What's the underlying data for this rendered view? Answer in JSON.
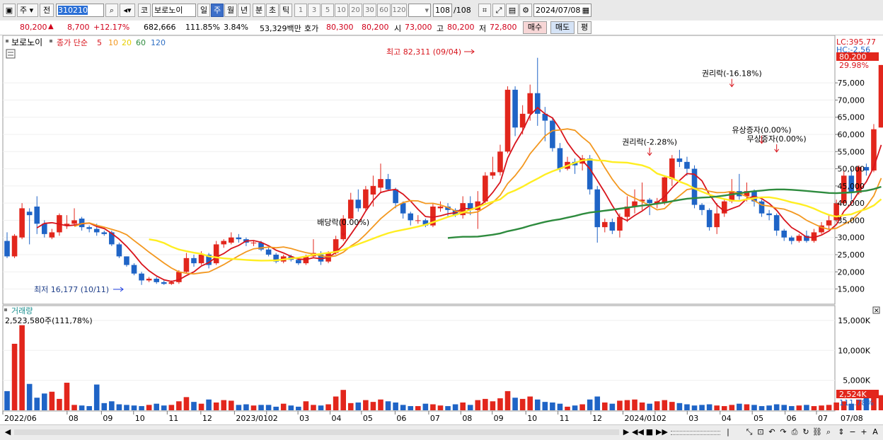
{
  "toolbar": {
    "type_label": "주",
    "prev_label": "전",
    "code_value": "310210",
    "name_value": "보로노이",
    "kospi_badge": "코",
    "periods": [
      "일",
      "주",
      "월",
      "년",
      "분",
      "초",
      "틱"
    ],
    "active_period": "주",
    "intervals": [
      "1",
      "3",
      "5",
      "10",
      "20",
      "30",
      "60",
      "120"
    ],
    "count_value": "108",
    "count_total": "/108",
    "date_value": "2024/07/08"
  },
  "quote": {
    "price": "80,200",
    "arrow": "▲",
    "change": "8,700",
    "change_rate": "+12.17%",
    "volume": "682,666",
    "volume_ratio": "111.85%",
    "turnover": "3.84%",
    "trade_value": "53,329백만",
    "ask_label": "호가",
    "ask1": "80,300",
    "ask2": "80,200",
    "open_label": "시",
    "open": "73,000",
    "high_label": "고",
    "high": "80,200",
    "low_label": "저",
    "low": "72,800",
    "buy_label": "매수",
    "sell_label": "매도",
    "eval_label": "평"
  },
  "colors": {
    "up": "#e2261c",
    "down": "#1f64c6",
    "ma5": "#d8141c",
    "ma10": "#f39820",
    "ma20": "#ffee22",
    "ma60": "#2e8b3e",
    "ma120": "#2e6fc4"
  },
  "legend": {
    "name": "보로노이",
    "series": "종가 단순",
    "periods": [
      "5",
      "10",
      "20",
      "60",
      "120"
    ]
  },
  "price_panel": {
    "lc_label": "LC:395.77",
    "hc_label": "HC:-2.56",
    "current_tag": "80,200",
    "current_pct": "29.98%",
    "hi_annot": "최고 82,311 (09/04)",
    "lo_annot": "최저 16,177 (10/11)",
    "events": [
      {
        "label": "배당락(0.00%)",
        "price": 31200,
        "week": 45
      },
      {
        "label": "권리락(-2.28%)",
        "price": 54500,
        "week": 86
      },
      {
        "label": "권리락(-16.18%)",
        "price": 74500,
        "week": 97
      },
      {
        "label": "유상증자(0.00%)",
        "price": 58000,
        "week": 101
      },
      {
        "label": "무상증자(0.00%)",
        "price": 55500,
        "week": 103
      },
      {
        "label": "배당락(0.00%)",
        "price": 56600,
        "week": 125
      }
    ]
  },
  "volume_panel": {
    "title": "거래량",
    "value_text": "2,523,580주(111,78%)",
    "current_tag": "2,524K",
    "current_pct": "111.78%"
  },
  "axes": {
    "x_labels": [
      "2022/06",
      "08",
      "09",
      "10",
      "11",
      "12",
      "2023/01",
      "02",
      "03",
      "04",
      "05",
      "06",
      "07",
      "08",
      "09",
      "10",
      "11",
      "12",
      "2024/01",
      "02",
      "03",
      "04",
      "05",
      "06",
      "07"
    ],
    "x_right": "07/08"
  },
  "chart_data": {
    "type": "candlestick",
    "price_ylim": [
      11000,
      88000
    ],
    "price_ticks": [
      15000,
      20000,
      25000,
      30000,
      35000,
      40000,
      45000,
      50000,
      55000,
      60000,
      65000,
      70000,
      75000
    ],
    "volume_ylim": [
      0,
      17000
    ],
    "volume_ticks": [
      5000,
      10000,
      15000
    ],
    "volume_unit": "K",
    "candles": [
      [
        29000,
        24500,
        31500,
        24000
      ],
      [
        24500,
        30500,
        31000,
        24000
      ],
      [
        30000,
        38500,
        40000,
        29500
      ],
      [
        37500,
        36500,
        38500,
        28000
      ],
      [
        39000,
        34000,
        42000,
        31000
      ],
      [
        34000,
        31000,
        35000,
        30000
      ],
      [
        30000,
        31500,
        32500,
        29500
      ],
      [
        31500,
        36500,
        37000,
        30500
      ],
      [
        33500,
        34000,
        36500,
        32500
      ],
      [
        34000,
        35000,
        38500,
        33500
      ],
      [
        35500,
        33000,
        36000,
        32000
      ],
      [
        33000,
        32500,
        33500,
        31500
      ],
      [
        32500,
        31500,
        34000,
        30500
      ],
      [
        31500,
        31000,
        32000,
        30500
      ],
      [
        31500,
        28000,
        32000,
        27500
      ],
      [
        28000,
        24500,
        28500,
        24000
      ],
      [
        24500,
        22000,
        24500,
        21500
      ],
      [
        22000,
        19500,
        22500,
        19000
      ],
      [
        19500,
        17500,
        20000,
        16200
      ],
      [
        17500,
        18000,
        18500,
        17000
      ],
      [
        18000,
        17000,
        18500,
        16500
      ],
      [
        17000,
        16500,
        17500,
        16200
      ],
      [
        16500,
        17000,
        17500,
        16200
      ],
      [
        17000,
        20000,
        20500,
        16500
      ],
      [
        20000,
        24000,
        25500,
        19500
      ],
      [
        24000,
        22500,
        25000,
        21500
      ],
      [
        22500,
        25000,
        26000,
        22000
      ],
      [
        25000,
        22000,
        25500,
        21000
      ],
      [
        22500,
        28000,
        29000,
        22000
      ],
      [
        28000,
        29000,
        29500,
        27000
      ],
      [
        28500,
        30000,
        31500,
        28000
      ],
      [
        30000,
        29500,
        31000,
        28500
      ],
      [
        29500,
        28500,
        30000,
        27500
      ],
      [
        28500,
        28500,
        29000,
        27500
      ],
      [
        28500,
        26500,
        29000,
        26000
      ],
      [
        26500,
        25000,
        27000,
        24500
      ],
      [
        25000,
        23000,
        25500,
        22500
      ],
      [
        23000,
        24500,
        25000,
        22500
      ],
      [
        24500,
        23500,
        25000,
        23000
      ],
      [
        23500,
        22500,
        24000,
        22000
      ],
      [
        22500,
        24500,
        25000,
        22000
      ],
      [
        24500,
        25500,
        29500,
        24000
      ],
      [
        25000,
        23000,
        26000,
        22000
      ],
      [
        23000,
        25500,
        26000,
        22500
      ],
      [
        25500,
        29500,
        30500,
        25000
      ],
      [
        29500,
        35500,
        36500,
        29000
      ],
      [
        35500,
        41000,
        43000,
        35000
      ],
      [
        41000,
        38500,
        44000,
        37500
      ],
      [
        38500,
        44000,
        45000,
        37500
      ],
      [
        42500,
        45000,
        48000,
        39000
      ],
      [
        44500,
        47000,
        51500,
        43000
      ],
      [
        47000,
        44000,
        48500,
        43500
      ],
      [
        44000,
        40000,
        44500,
        38500
      ],
      [
        40000,
        37000,
        40500,
        35500
      ],
      [
        37000,
        35000,
        37500,
        33500
      ],
      [
        35000,
        35000,
        36500,
        34000
      ],
      [
        35000,
        33500,
        35500,
        33000
      ],
      [
        33500,
        39000,
        40000,
        33000
      ],
      [
        38500,
        39000,
        40500,
        37500
      ],
      [
        39000,
        38000,
        40000,
        36000
      ],
      [
        38000,
        36500,
        38500,
        36000
      ],
      [
        36500,
        40000,
        42000,
        35500
      ],
      [
        40000,
        38000,
        42000,
        36500
      ],
      [
        38000,
        40500,
        43500,
        32500
      ],
      [
        40500,
        48000,
        49000,
        40000
      ],
      [
        48000,
        49000,
        53500,
        47000
      ],
      [
        49000,
        55000,
        57000,
        48000
      ],
      [
        55000,
        73000,
        74000,
        54500
      ],
      [
        73000,
        62000,
        74000,
        59500
      ],
      [
        62000,
        66000,
        68500,
        60000
      ],
      [
        66000,
        72000,
        74500,
        64000
      ],
      [
        72000,
        66000,
        82300,
        62500
      ],
      [
        66000,
        64000,
        68000,
        58000
      ],
      [
        64000,
        56000,
        65000,
        55000
      ],
      [
        56000,
        50000,
        57500,
        49000
      ],
      [
        50000,
        52000,
        53500,
        49500
      ],
      [
        52000,
        51000,
        53000,
        48500
      ],
      [
        51500,
        53000,
        54000,
        49500
      ],
      [
        53000,
        44000,
        54000,
        42500
      ],
      [
        44000,
        33000,
        45000,
        28500
      ],
      [
        33000,
        34500,
        35500,
        31500
      ],
      [
        34500,
        32000,
        35500,
        31000
      ],
      [
        32000,
        36000,
        37000,
        30000
      ],
      [
        36000,
        39000,
        42000,
        34500
      ],
      [
        39000,
        40500,
        44000,
        37000
      ],
      [
        40500,
        41000,
        46000,
        38000
      ],
      [
        41000,
        40000,
        41500,
        36500
      ],
      [
        40000,
        40500,
        41500,
        38500
      ],
      [
        40000,
        47500,
        48000,
        39500
      ],
      [
        47000,
        53000,
        54000,
        45000
      ],
      [
        53000,
        52000,
        55500,
        50500
      ],
      [
        52000,
        50000,
        53500,
        48000
      ],
      [
        50000,
        39500,
        51000,
        38500
      ],
      [
        39500,
        38000,
        40000,
        36500
      ],
      [
        38000,
        33000,
        38500,
        32000
      ],
      [
        33000,
        37000,
        40000,
        31000
      ],
      [
        37000,
        40500,
        41000,
        36000
      ],
      [
        40500,
        43500,
        47000,
        40000
      ],
      [
        43500,
        42000,
        48500,
        41000
      ],
      [
        42000,
        43500,
        46000,
        40500
      ],
      [
        43500,
        40500,
        44000,
        39000
      ],
      [
        40500,
        37000,
        41000,
        36000
      ],
      [
        37000,
        36500,
        38000,
        35000
      ],
      [
        36500,
        32000,
        37000,
        30500
      ],
      [
        32000,
        30000,
        32500,
        29000
      ],
      [
        30000,
        29000,
        30500,
        28000
      ],
      [
        29000,
        30500,
        31000,
        28500
      ],
      [
        30500,
        29000,
        32000,
        28500
      ],
      [
        29000,
        31500,
        32500,
        28500
      ],
      [
        31500,
        33500,
        34500,
        31000
      ],
      [
        33500,
        35000,
        36500,
        32500
      ],
      [
        35000,
        40000,
        41000,
        34500
      ],
      [
        40000,
        48000,
        49500,
        39500
      ],
      [
        48000,
        43000,
        50000,
        41000
      ],
      [
        43000,
        50500,
        51000,
        42500
      ],
      [
        50500,
        49500,
        51500,
        48000
      ],
      [
        49500,
        61500,
        63000,
        49000
      ],
      [
        62000,
        80200,
        80200,
        62000
      ]
    ],
    "volumes": [
      3200,
      11100,
      14200,
      4400,
      2100,
      2800,
      3100,
      1900,
      4600,
      900,
      800,
      700,
      4300,
      1200,
      1500,
      1000,
      900,
      800,
      700,
      900,
      1100,
      800,
      900,
      1500,
      2200,
      1400,
      1100,
      1800,
      1300,
      1700,
      1600,
      900,
      1000,
      800,
      900,
      900,
      600,
      1100,
      800,
      600,
      1500,
      900,
      800,
      1000,
      2300,
      3400,
      1200,
      1300,
      1700,
      1400,
      1800,
      1500,
      1300,
      900,
      700,
      700,
      1100,
      1000,
      800,
      700,
      1000,
      1300,
      900,
      1700,
      1900,
      1500,
      2000,
      3200,
      2100,
      1900,
      2300,
      1800,
      1400,
      1300,
      1100,
      600,
      800,
      1000,
      1800,
      2300,
      1300,
      1100,
      1600,
      1700,
      1800,
      1300,
      1100,
      1500,
      1700,
      1400,
      1200,
      1000,
      800,
      900,
      1000,
      800,
      700,
      900,
      1100,
      1000,
      900,
      700,
      800,
      1000,
      900,
      700,
      800,
      900,
      700,
      800,
      900,
      1300,
      1500,
      1100,
      1800,
      2100,
      2400,
      2524
    ],
    "series": [
      {
        "name": "5",
        "color": "#d8141c"
      },
      {
        "name": "10",
        "color": "#f39820"
      },
      {
        "name": "20",
        "color": "#ffee22"
      },
      {
        "name": "60",
        "color": "#2e8b3e"
      },
      {
        "name": "120",
        "color": "#2e6fc4"
      }
    ]
  }
}
